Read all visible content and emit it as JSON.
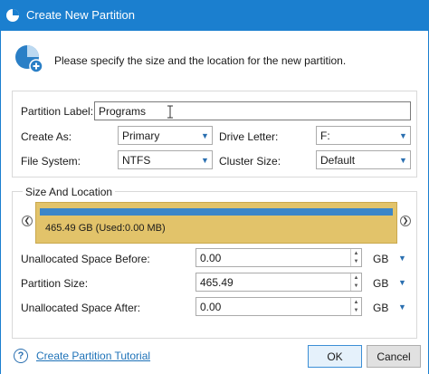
{
  "window": {
    "title": "Create New Partition"
  },
  "header": {
    "instruction": "Please specify the size and the location for the new partition."
  },
  "form": {
    "partition_label": {
      "label": "Partition Label:",
      "value": "Programs"
    },
    "create_as": {
      "label": "Create As:",
      "value": "Primary"
    },
    "drive_letter": {
      "label": "Drive Letter:",
      "value": "F:"
    },
    "file_system": {
      "label": "File System:",
      "value": "NTFS"
    },
    "cluster_size": {
      "label": "Cluster Size:",
      "value": "Default"
    }
  },
  "size_location": {
    "title": "Size And Location",
    "partition_bar_text": "465.49 GB (Used:0.00 MB)",
    "used_fraction": 0.0,
    "unallocated_before": {
      "label": "Unallocated Space Before:",
      "value": "0.00",
      "unit": "GB"
    },
    "partition_size": {
      "label": "Partition Size:",
      "value": "465.49",
      "unit": "GB"
    },
    "unallocated_after": {
      "label": "Unallocated Space After:",
      "value": "0.00",
      "unit": "GB"
    }
  },
  "footer": {
    "tutorial_link": "Create Partition Tutorial",
    "ok_label": "OK",
    "cancel_label": "Cancel"
  },
  "colors": {
    "titlebar": "#1b7fcf",
    "partition_fill": "#e2c36a",
    "partition_stripe": "#3b86c8",
    "link": "#1e72b8"
  },
  "icons": {
    "app": "partition-wizard-icon",
    "header": "add-partition-icon",
    "help": "help-icon"
  }
}
